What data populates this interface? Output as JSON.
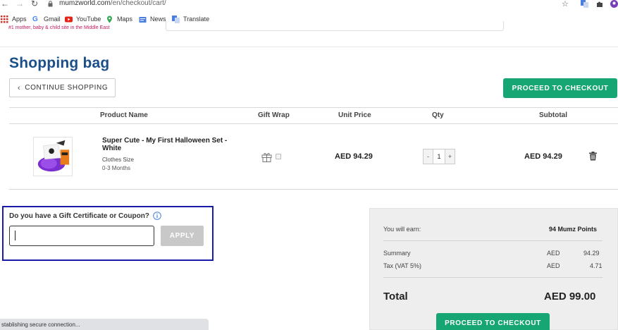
{
  "browser": {
    "url_host": "mumzworld.com",
    "url_path": "/en/checkout/cart/",
    "bookmarks": [
      "Apps",
      "Gmail",
      "YouTube",
      "Maps",
      "News",
      "Translate"
    ]
  },
  "site": {
    "tagline": "#1 mother, baby & child site in the Middle East"
  },
  "cart": {
    "title": "Shopping bag",
    "continue_label": "CONTINUE SHOPPING",
    "proceed_label": "PROCEED TO CHECKOUT",
    "columns": {
      "product_name": "Product Name",
      "gift_wrap": "Gift Wrap",
      "unit_price": "Unit Price",
      "qty": "Qty",
      "subtotal": "Subtotal"
    },
    "items": [
      {
        "name": "Super Cute - My First Halloween Set - White",
        "size_label": "Clothes Size",
        "size_value": "0-3 Months",
        "unit_price": "AED 94.29",
        "qty_minus": "-",
        "qty": "1",
        "qty_plus": "+",
        "subtotal": "AED 94.29"
      }
    ]
  },
  "coupon": {
    "question": "Do you have a Gift Certificate or Coupon?",
    "input_value": "",
    "apply_label": "APPLY"
  },
  "summary": {
    "earn_label": "You will earn:",
    "earn_value": "94 Mumz Points",
    "summary_label": "Summary",
    "summary_currency": "AED",
    "summary_value": "94.29",
    "tax_label": "Tax (VAT 5%)",
    "tax_currency": "AED",
    "tax_value": "4.71",
    "total_label": "Total",
    "total_value": "AED 99.00",
    "proceed_label": "PROCEED TO CHECKOUT"
  },
  "status": {
    "text": "stablishing secure connection..."
  },
  "colors": {
    "brand_blue": "#1a4f8a",
    "green": "#16a673",
    "highlight": "#1a1aa8"
  }
}
